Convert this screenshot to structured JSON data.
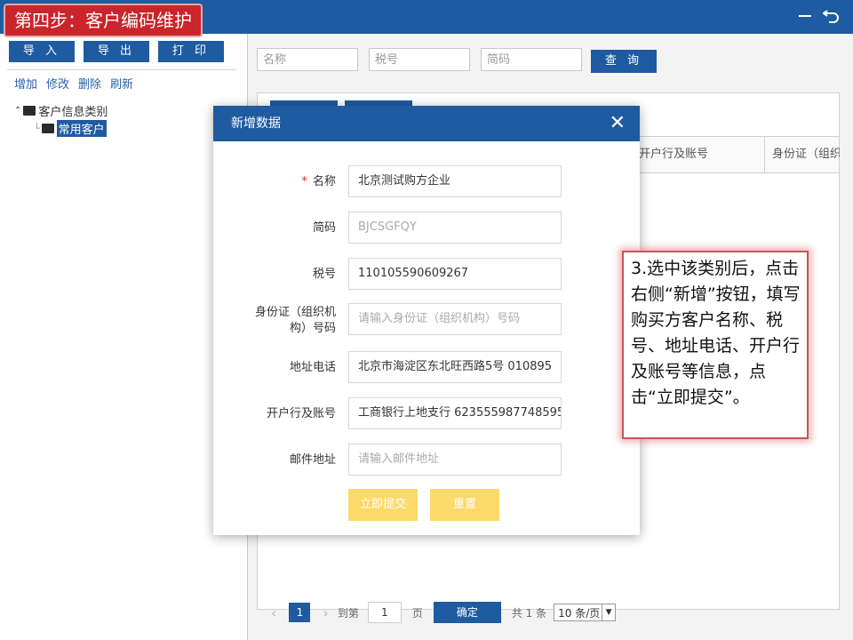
{
  "banner": {
    "text": "第四步：客户编码维护"
  },
  "top_icons": [
    "minimize-icon",
    "back-icon"
  ],
  "toolbar": {
    "import_label": "导 入",
    "export_label": "导 出",
    "print_label": "打 印"
  },
  "links": {
    "add": "增加",
    "edit": "修改",
    "delete": "删除",
    "refresh": "刷新"
  },
  "tree": {
    "root": "客户信息类别",
    "child": "常用客户"
  },
  "search": {
    "name_placeholder": "名称",
    "tax_placeholder": "税号",
    "abbr_placeholder": "简码",
    "query_label": "查 询"
  },
  "grid": {
    "col_bank": "开户行及账号",
    "col_id": "身份证（组织"
  },
  "pager": {
    "page": "1",
    "goto": "到第",
    "goto_value": "1",
    "page_unit": "页",
    "confirm": "确定",
    "total": "共 1 条",
    "size": "10 条/页"
  },
  "modal": {
    "title": "新增数据",
    "fields": {
      "name": {
        "label": "名称",
        "required": "*",
        "value": "北京测试购方企业"
      },
      "abbr": {
        "label": "简码",
        "placeholder": "BJCSGFQY"
      },
      "tax": {
        "label": "税号",
        "value": "110105590609267"
      },
      "idcard": {
        "label_line1": "身份证（组织机",
        "label_line2": "构）号码",
        "placeholder": "请输入身份证（组织机构）号码"
      },
      "address": {
        "label": "地址电话",
        "value": "北京市海淀区东北旺西路5号  010895"
      },
      "bank": {
        "label": "开户行及账号",
        "value": "工商银行上地支行 623555987748595"
      },
      "email": {
        "label": "邮件地址",
        "placeholder": "请输入邮件地址"
      }
    },
    "submit": "立即提交",
    "reset": "重置"
  },
  "callout": {
    "text": "3.选中该类别后，点击右侧“新增”按钮，填写购买方客户名称、税号、地址电话、开户行及账号等信息，点击“立即提交”。"
  }
}
